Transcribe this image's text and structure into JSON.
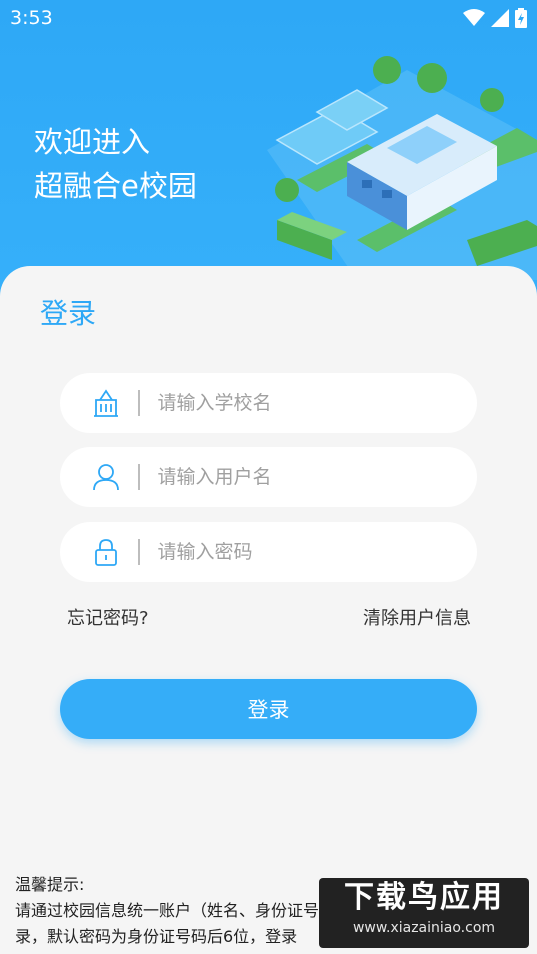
{
  "status_bar": {
    "time": "3:53",
    "icons": [
      "wifi-icon",
      "signal-icon",
      "battery-icon"
    ]
  },
  "header": {
    "line1": "欢迎进入",
    "line2": "超融合e校园"
  },
  "login_card": {
    "title": "登录",
    "fields": {
      "school": {
        "placeholder": "请输入学校名",
        "icon": "school-building-icon"
      },
      "username": {
        "placeholder": "请输入用户名",
        "icon": "user-icon"
      },
      "password": {
        "placeholder": "请输入密码",
        "icon": "lock-icon"
      }
    },
    "forgot_password": "忘记密码?",
    "clear_user_info": "清除用户信息",
    "login_button": "登录"
  },
  "tips": {
    "title": "温馨提示:",
    "line1": "请通过校园信息统一账户（姓名、身份证号",
    "line2": "录，默认密码为身份证号码后6位，登录"
  },
  "watermark": {
    "title": "下载鸟应用",
    "url": "www.xiazainiao.com"
  },
  "colors": {
    "primary": "#2EA8F6",
    "card_bg": "#F5F5F5",
    "button": "#35ADF8"
  }
}
